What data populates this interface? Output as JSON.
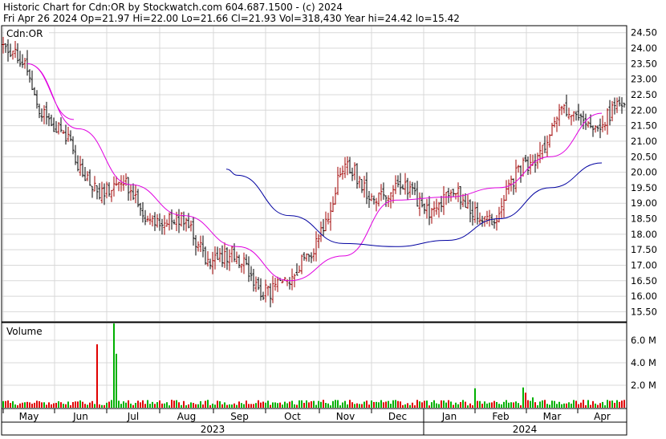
{
  "header": {
    "line1": "Historic Chart for Cdn:OR by Stockwatch.com 604.687.1500 - (c) 2024",
    "line2": "Fri Apr 26 2024  Op=21.97  Hi=22.00  Lo=21.66  Cl=21.93  Vol=318,430  Year hi=24.42  lo=15.42"
  },
  "price_panel": {
    "label": "Cdn:OR"
  },
  "volume_panel": {
    "label": "Volume"
  },
  "colors": {
    "up": "#a00000",
    "down": "#000000",
    "ma_short": "#e000e0",
    "ma_long": "#0000a0",
    "volume_up": "#00b000",
    "volume_down": "#e00000",
    "grid": "#d8d8d8"
  },
  "chart_data": {
    "type": "bar",
    "description_of_marks": "daily OHLC price bars with two moving averages; daily volume bars",
    "x_month_labels": [
      "May",
      "Jun",
      "Jul",
      "Aug",
      "Sep",
      "Oct",
      "Nov",
      "Dec",
      "Jan",
      "Feb",
      "Mar",
      "Apr"
    ],
    "x_year_labels": [
      "2023",
      "2024"
    ],
    "price_axis": {
      "ylim": [
        15.2,
        24.7
      ],
      "ticks": [
        "15.50",
        "16.00",
        "16.50",
        "17.00",
        "17.50",
        "18.00",
        "18.50",
        "19.00",
        "19.50",
        "20.00",
        "20.50",
        "21.00",
        "21.50",
        "22.00",
        "22.50",
        "23.00",
        "23.50",
        "24.00",
        "24.50"
      ]
    },
    "volume_axis": {
      "ylim": [
        0,
        7.5
      ],
      "ticks": [
        "2.0 M",
        "4.0 M",
        "6.0 M"
      ]
    },
    "close_series_approx": [
      {
        "month": "May",
        "close": 23.2
      },
      {
        "month": "Jun",
        "close": 20.0
      },
      {
        "month": "Jul",
        "close": 19.2
      },
      {
        "month": "Aug",
        "close": 18.1
      },
      {
        "month": "Sep",
        "close": 16.9
      },
      {
        "month": "Oct",
        "close": 16.1
      },
      {
        "month": "Nov",
        "close": 19.9
      },
      {
        "month": "Dec",
        "close": 19.3
      },
      {
        "month": "Jan",
        "close": 19.0
      },
      {
        "month": "Feb",
        "close": 18.6
      },
      {
        "month": "Mar",
        "close": 21.6
      },
      {
        "month": "Apr",
        "close": 21.9
      }
    ],
    "series": [
      {
        "name": "ma_short",
        "values": [
          23.5,
          21.4,
          19.6,
          18.6,
          17.6,
          16.5,
          17.3,
          19.1,
          19.2,
          19.5,
          20.5,
          21.9
        ]
      },
      {
        "name": "ma_long",
        "values": [
          null,
          null,
          null,
          null,
          19.9,
          18.6,
          17.7,
          17.6,
          17.8,
          18.5,
          19.5,
          20.3
        ]
      }
    ],
    "volume_series_approx": [
      {
        "month": "May",
        "millions": 0.6
      },
      {
        "month": "Jun",
        "millions": 7.5
      },
      {
        "month": "Jul",
        "millions": 0.8
      },
      {
        "month": "Aug",
        "millions": 0.6
      },
      {
        "month": "Sep",
        "millions": 0.5
      },
      {
        "month": "Oct",
        "millions": 0.7
      },
      {
        "month": "Nov",
        "millions": 1.7
      },
      {
        "month": "Dec",
        "millions": 0.8
      },
      {
        "month": "Jan",
        "millions": 0.7
      },
      {
        "month": "Feb",
        "millions": 1.9
      },
      {
        "month": "Mar",
        "millions": 1.5
      },
      {
        "month": "Apr",
        "millions": 0.8
      }
    ],
    "grid": true
  }
}
